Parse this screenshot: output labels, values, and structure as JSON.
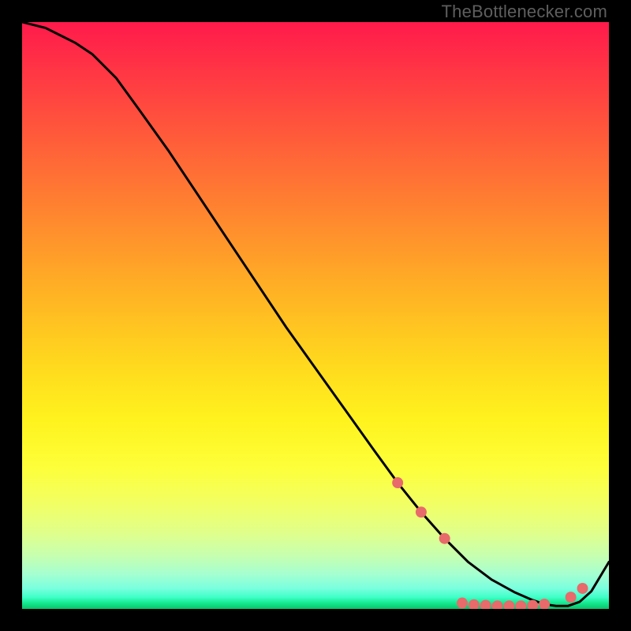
{
  "watermark": "TheBottlenecker.com",
  "chart_data": {
    "type": "line",
    "title": "",
    "xlabel": "",
    "ylabel": "",
    "xlim": [
      0,
      100
    ],
    "ylim": [
      0,
      100
    ],
    "x": [
      0,
      2,
      4,
      6,
      9,
      12,
      16,
      20,
      25,
      30,
      35,
      40,
      45,
      50,
      55,
      60,
      64,
      68,
      72,
      76,
      80,
      84,
      87,
      89,
      91,
      93,
      95,
      97,
      100
    ],
    "y": [
      100,
      99.5,
      99,
      98,
      96.5,
      94.5,
      90.5,
      85,
      78,
      70.5,
      63,
      55.5,
      48,
      41,
      34,
      27,
      21.5,
      16.5,
      12,
      8,
      5,
      2.8,
      1.5,
      0.8,
      0.5,
      0.5,
      1.2,
      3,
      8
    ],
    "markers": {
      "color": "#e86a6a",
      "radius_px": 7,
      "points": [
        {
          "x": 64,
          "y": 21.5
        },
        {
          "x": 68,
          "y": 16.5
        },
        {
          "x": 72,
          "y": 12
        },
        {
          "x": 75,
          "y": 1.0
        },
        {
          "x": 77,
          "y": 0.7
        },
        {
          "x": 79,
          "y": 0.6
        },
        {
          "x": 81,
          "y": 0.5
        },
        {
          "x": 83,
          "y": 0.5
        },
        {
          "x": 85,
          "y": 0.5
        },
        {
          "x": 87,
          "y": 0.6
        },
        {
          "x": 89,
          "y": 0.8
        },
        {
          "x": 93.5,
          "y": 2.0
        },
        {
          "x": 95.5,
          "y": 3.5
        }
      ]
    },
    "gradient_stops": [
      {
        "pos": 0,
        "color": "#ff1a4b"
      },
      {
        "pos": 10,
        "color": "#ff3b43"
      },
      {
        "pos": 22,
        "color": "#ff6338"
      },
      {
        "pos": 34,
        "color": "#ff8a2e"
      },
      {
        "pos": 46,
        "color": "#ffb224"
      },
      {
        "pos": 58,
        "color": "#ffd81e"
      },
      {
        "pos": 68,
        "color": "#fff31e"
      },
      {
        "pos": 76,
        "color": "#fdff3a"
      },
      {
        "pos": 82,
        "color": "#f2ff63"
      },
      {
        "pos": 87,
        "color": "#e0ff8a"
      },
      {
        "pos": 91,
        "color": "#c6ffb0"
      },
      {
        "pos": 94,
        "color": "#a6ffd0"
      },
      {
        "pos": 96.5,
        "color": "#7affde"
      },
      {
        "pos": 98,
        "color": "#3fffc8"
      },
      {
        "pos": 99,
        "color": "#14e98f"
      },
      {
        "pos": 100,
        "color": "#0ac46a"
      }
    ]
  }
}
